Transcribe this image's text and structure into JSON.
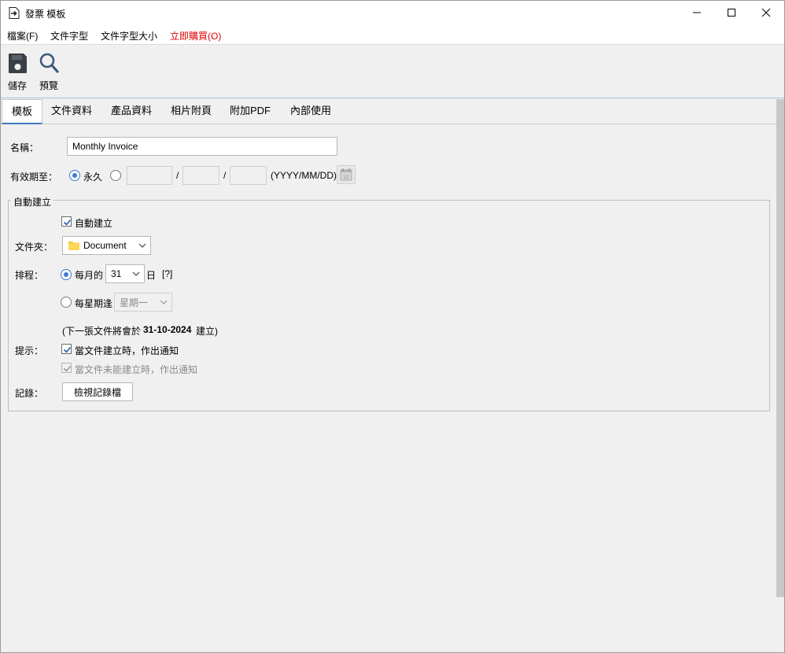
{
  "window": {
    "title": "發票 模板"
  },
  "menu": {
    "file": "檔案(F)",
    "font": "文件字型",
    "font_size": "文件字型大小",
    "buy": "立即購買(O)"
  },
  "toolbar": {
    "save": "儲存",
    "preview": "預覽"
  },
  "tabs": [
    "模板",
    "文件資料",
    "產品資料",
    "相片附頁",
    "附加PDF",
    "內部使用"
  ],
  "form": {
    "name_label": "名稱：",
    "name_value": "Monthly Invoice",
    "valid_label": "有效期至：",
    "forever_label": "永久",
    "date_sep": "/",
    "date_format": "(YYYY/MM/DD)",
    "auto_group_title": "自動建立",
    "auto_create_label": "自動建立",
    "folder_label": "文件夾：",
    "folder_value": "Document",
    "schedule_label": "排程：",
    "monthly_label": "每月的",
    "monthly_day": "31",
    "day_suffix": "日",
    "help_mark": "[?]",
    "weekly_label": "每星期逢",
    "weekly_day": "星期一",
    "next_prefix": "(下一張文件將會於",
    "next_date": "31-10-2024",
    "next_suffix": "建立)",
    "notify_label": "提示：",
    "notify_created": "當文件建立時，作出通知",
    "notify_failed": "當文件未能建立時，作出通知",
    "log_label": "記錄：",
    "log_button": "檢視記錄檔"
  },
  "colors": {
    "accent": "#3a7bd5",
    "buy_menu": "#e00000",
    "tab_underline": "#3f79c0"
  }
}
